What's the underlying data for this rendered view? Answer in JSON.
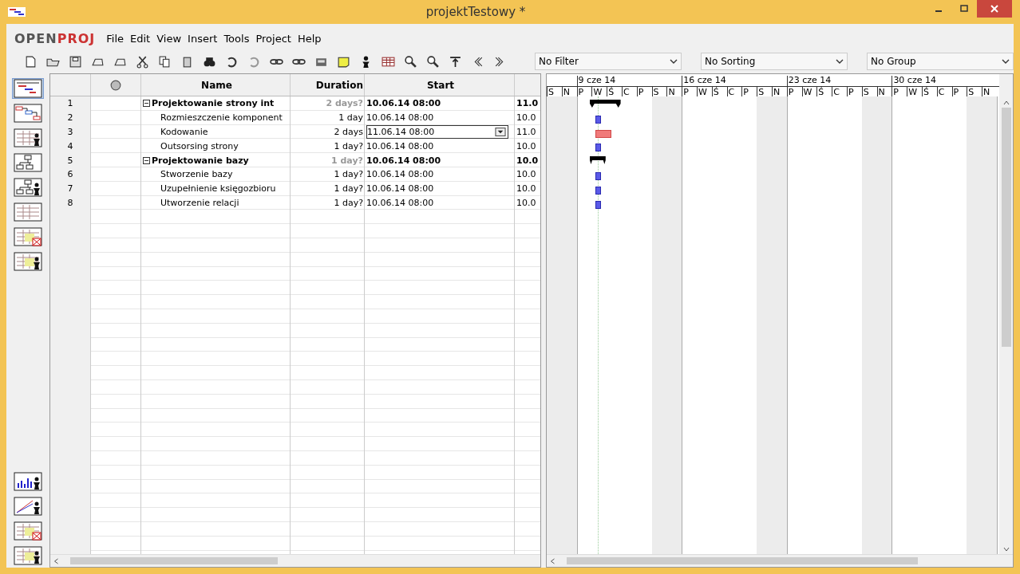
{
  "window": {
    "title": "projektTestowy *"
  },
  "logo": [
    "OPEN",
    "PROJ"
  ],
  "menu": [
    "File",
    "Edit",
    "View",
    "Insert",
    "Tools",
    "Project",
    "Help"
  ],
  "toolbar_dropdowns": [
    {
      "value": "No Filter"
    },
    {
      "value": "No Sorting"
    },
    {
      "value": "No Group"
    }
  ],
  "view_bar": {
    "top": [
      {
        "kind": "gantt",
        "selected": true
      },
      {
        "kind": "network",
        "selected": false
      },
      {
        "kind": "resource-sheet",
        "selected": false
      },
      {
        "kind": "wbs",
        "selected": false
      },
      {
        "kind": "rbs",
        "selected": false
      },
      {
        "kind": "sheet",
        "selected": false
      },
      {
        "kind": "task-usage",
        "selected": false
      },
      {
        "kind": "resource-usage",
        "selected": false
      }
    ],
    "bottom": [
      {
        "kind": "histogram",
        "selected": false
      },
      {
        "kind": "charts",
        "selected": false
      },
      {
        "kind": "task-usage",
        "selected": false
      },
      {
        "kind": "resource-usage",
        "selected": false
      }
    ]
  },
  "table": {
    "columns": [
      "Name",
      "Duration",
      "Start"
    ],
    "rows": [
      {
        "id": "1",
        "kind": "summary",
        "expanded": true,
        "name": "Projektowanie strony int",
        "duration": "2 days?",
        "start": "10.06.14 08:00",
        "column_6": "11.0",
        "editing": false
      },
      {
        "id": "2",
        "kind": "task",
        "name": "Rozmieszczenie komponent",
        "duration": "1 day",
        "start": "10.06.14 08:00",
        "column_6": "10.0",
        "editing": false,
        "critical": false
      },
      {
        "id": "3",
        "kind": "task",
        "name": "Kodowanie",
        "duration": "2 days",
        "start": "11.06.14 08:00",
        "column_6": "11.0",
        "editing": true,
        "critical": true
      },
      {
        "id": "4",
        "kind": "task",
        "name": "Outsorsing strony",
        "duration": "1 day?",
        "start": "10.06.14 08:00",
        "column_6": "10.0",
        "editing": false,
        "critical": false
      },
      {
        "id": "5",
        "kind": "summary",
        "expanded": true,
        "name": "Projektowanie bazy",
        "duration": "1 day?",
        "start": "10.06.14 08:00",
        "column_6": "10.0",
        "editing": false
      },
      {
        "id": "6",
        "kind": "task",
        "name": "Stworzenie bazy",
        "duration": "1 day?",
        "start": "10.06.14 08:00",
        "column_6": "10.0",
        "editing": false,
        "critical": false
      },
      {
        "id": "7",
        "kind": "task",
        "name": "Uzupełnienie księgozbioru",
        "duration": "1 day?",
        "start": "10.06.14 08:00",
        "column_6": "10.0",
        "editing": false,
        "critical": false
      },
      {
        "id": "8",
        "kind": "task",
        "name": "Utworzenie relacji",
        "duration": "1 day?",
        "start": "10.06.14 08:00",
        "column_6": "10.0",
        "editing": false,
        "critical": false
      }
    ]
  },
  "timescale": {
    "weeks": [
      "9 cze 14",
      "16 cze 14",
      "23 cze 14",
      "30 cze 14"
    ],
    "days": [
      "S",
      "N",
      "P",
      "W",
      "Ś",
      "C",
      "P",
      "S",
      "N",
      "P",
      "W",
      "Ś",
      "C",
      "P",
      "S",
      "N",
      "P",
      "W",
      "Ś",
      "C",
      "P",
      "S",
      "N",
      "P",
      "W",
      "Ś",
      "C",
      "P",
      "S",
      "N"
    ]
  }
}
